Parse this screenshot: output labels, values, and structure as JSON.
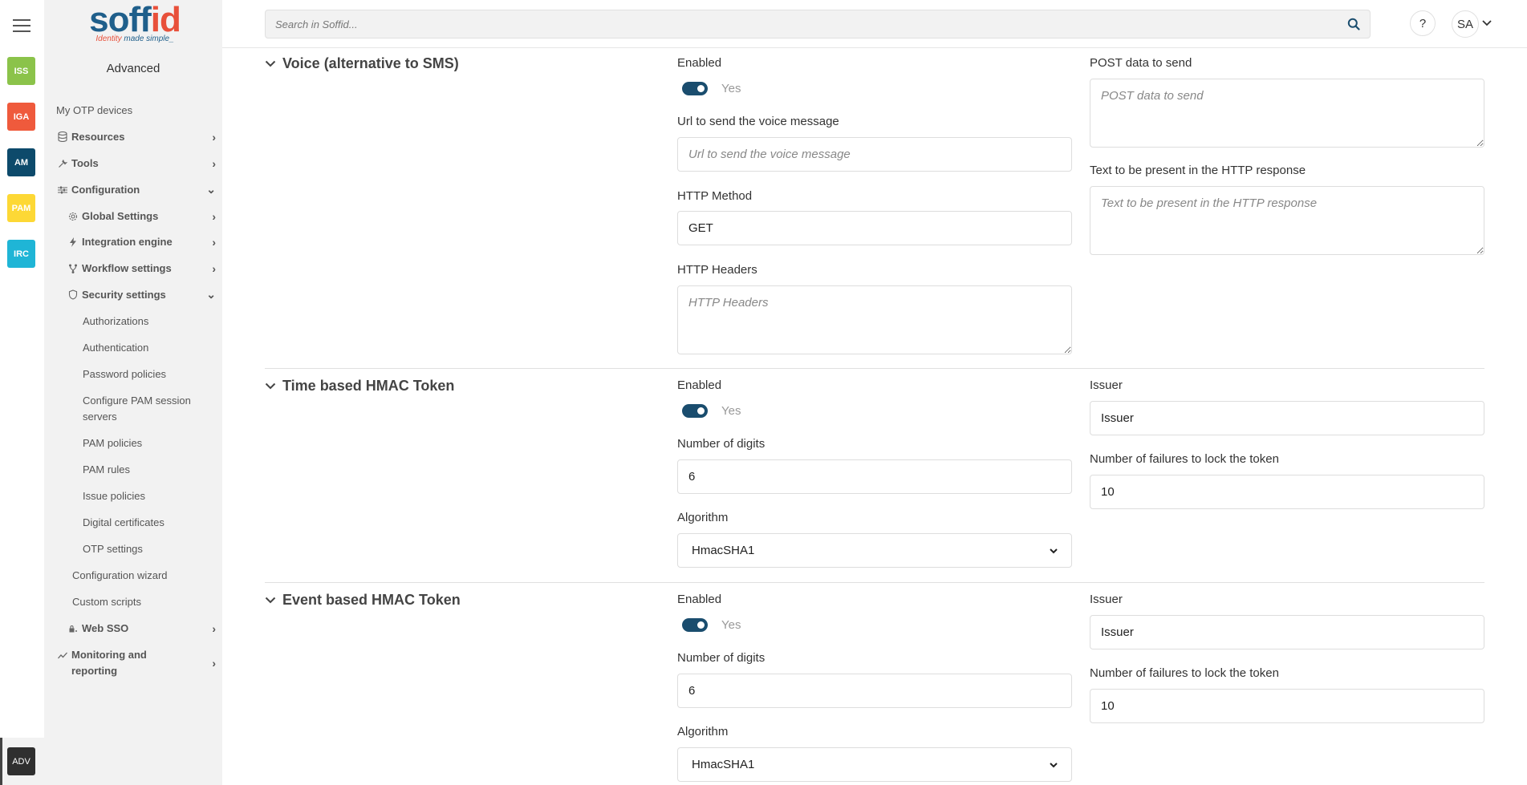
{
  "rail": {
    "apps": [
      {
        "label": "ISS",
        "color": "#8bc34a"
      },
      {
        "label": "IGA",
        "color": "#ef5a3c"
      },
      {
        "label": "AM",
        "color": "#0d4a6b"
      },
      {
        "label": "PAM",
        "color": "#fdd835"
      },
      {
        "label": "IRC",
        "color": "#1fb5d6"
      }
    ],
    "active_app": "ADV"
  },
  "logo": {
    "word_a": "soff",
    "word_b": "id",
    "tagline_a": "Identity",
    "tagline_b": " made simple_"
  },
  "sidebar": {
    "title": "Advanced",
    "items": [
      {
        "label": "My OTP devices"
      },
      {
        "label": "Resources",
        "icon": "database-icon"
      },
      {
        "label": "Tools",
        "icon": "wrench-icon"
      },
      {
        "label": "Configuration",
        "icon": "sliders-icon"
      },
      {
        "label": "Global Settings",
        "icon": "gear-icon"
      },
      {
        "label": "Integration engine",
        "icon": "bolt-icon"
      },
      {
        "label": "Workflow settings",
        "icon": "fork-icon"
      },
      {
        "label": "Security settings",
        "icon": "shield-icon"
      },
      {
        "label": "Authorizations"
      },
      {
        "label": "Authentication"
      },
      {
        "label": "Password policies"
      },
      {
        "label": "Configure PAM session servers"
      },
      {
        "label": "PAM policies"
      },
      {
        "label": "PAM rules"
      },
      {
        "label": "Issue policies"
      },
      {
        "label": "Digital certificates"
      },
      {
        "label": "OTP settings"
      },
      {
        "label": "Configuration wizard"
      },
      {
        "label": "Custom scripts"
      },
      {
        "label": "Web SSO",
        "icon": "lock-icon"
      },
      {
        "label": "Monitoring and reporting",
        "icon": "chart-line-icon"
      }
    ]
  },
  "header": {
    "search_placeholder": "Search in Soffid...",
    "help_label": "?",
    "user_initials": "SA"
  },
  "sections": {
    "voice": {
      "title": "Voice (alternative to SMS)",
      "enabled_label": "Enabled",
      "enabled_value": "Yes",
      "url_label": "Url to send the voice message",
      "url_placeholder": "Url to send the voice message",
      "method_label": "HTTP Method",
      "method_value": "GET",
      "headers_label": "HTTP Headers",
      "headers_placeholder": "HTTP Headers",
      "post_label": "POST data to send",
      "post_placeholder": "POST data to send",
      "response_label": "Text to be present in the HTTP response",
      "response_placeholder": "Text to be present in the HTTP response"
    },
    "time_hmac": {
      "title": "Time based HMAC Token",
      "enabled_label": "Enabled",
      "enabled_value": "Yes",
      "digits_label": "Number of digits",
      "digits_value": "6",
      "algorithm_label": "Algorithm",
      "algorithm_value": "HmacSHA1",
      "issuer_label": "Issuer",
      "issuer_value": "Issuer",
      "failures_label": "Number of failures to lock the token",
      "failures_value": "10"
    },
    "event_hmac": {
      "title": "Event based HMAC Token",
      "enabled_label": "Enabled",
      "enabled_value": "Yes",
      "digits_label": "Number of digits",
      "digits_value": "6",
      "algorithm_label": "Algorithm",
      "algorithm_value": "HmacSHA1",
      "issuer_label": "Issuer",
      "issuer_value": "Issuer",
      "failures_label": "Number of failures to lock the token",
      "failures_value": "10"
    }
  }
}
